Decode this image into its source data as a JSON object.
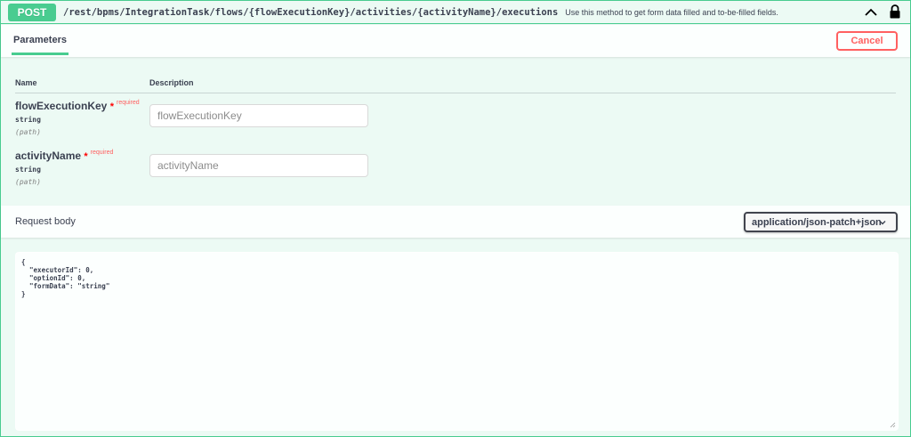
{
  "operation": {
    "method": "POST",
    "path": "/rest/bpms/IntegrationTask/flows/{flowExecutionKey}/activities/{activityName}/executions",
    "summary": "Use this method to get form data filled and to-be-filled fields.",
    "icons": {
      "collapse": "chevron-up-icon",
      "auth": "lock-icon"
    },
    "colors": {
      "post": "#49cc90",
      "cancel": "#ff6060",
      "required": "#ff0000"
    }
  },
  "tabs": {
    "parameters_label": "Parameters",
    "cancel_label": "Cancel"
  },
  "params_table": {
    "col_name": "Name",
    "col_description": "Description",
    "rows": [
      {
        "name": "flowExecutionKey",
        "required_star": "*",
        "required_label": "required",
        "type": "string",
        "in": "(path)",
        "placeholder": "flowExecutionKey"
      },
      {
        "name": "activityName",
        "required_star": "*",
        "required_label": "required",
        "type": "string",
        "in": "(path)",
        "placeholder": "activityName"
      }
    ]
  },
  "request_body": {
    "title": "Request body",
    "content_type": "application/json-patch+json",
    "example": "{\n  \"executorId\": 0,\n  \"optionId\": 0,\n  \"formData\": \"string\"\n}"
  }
}
